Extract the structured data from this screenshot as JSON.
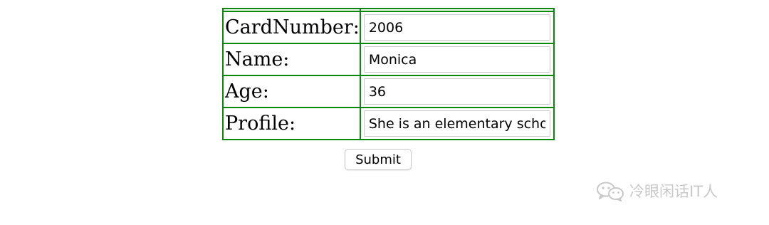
{
  "form": {
    "rows": [
      {
        "label": "CardNumber:",
        "value": "2006"
      },
      {
        "label": "Name:",
        "value": "Monica"
      },
      {
        "label": "Age:",
        "value": "36"
      },
      {
        "label": "Profile:",
        "value": "She is an elementary school teacher"
      }
    ],
    "submit_label": "Submit"
  },
  "watermark": {
    "text": "冷眼闲话IT人",
    "icon": "wechat-icon"
  },
  "colors": {
    "table_border": "#0a8a0a",
    "watermark": "#c8c8c8"
  }
}
